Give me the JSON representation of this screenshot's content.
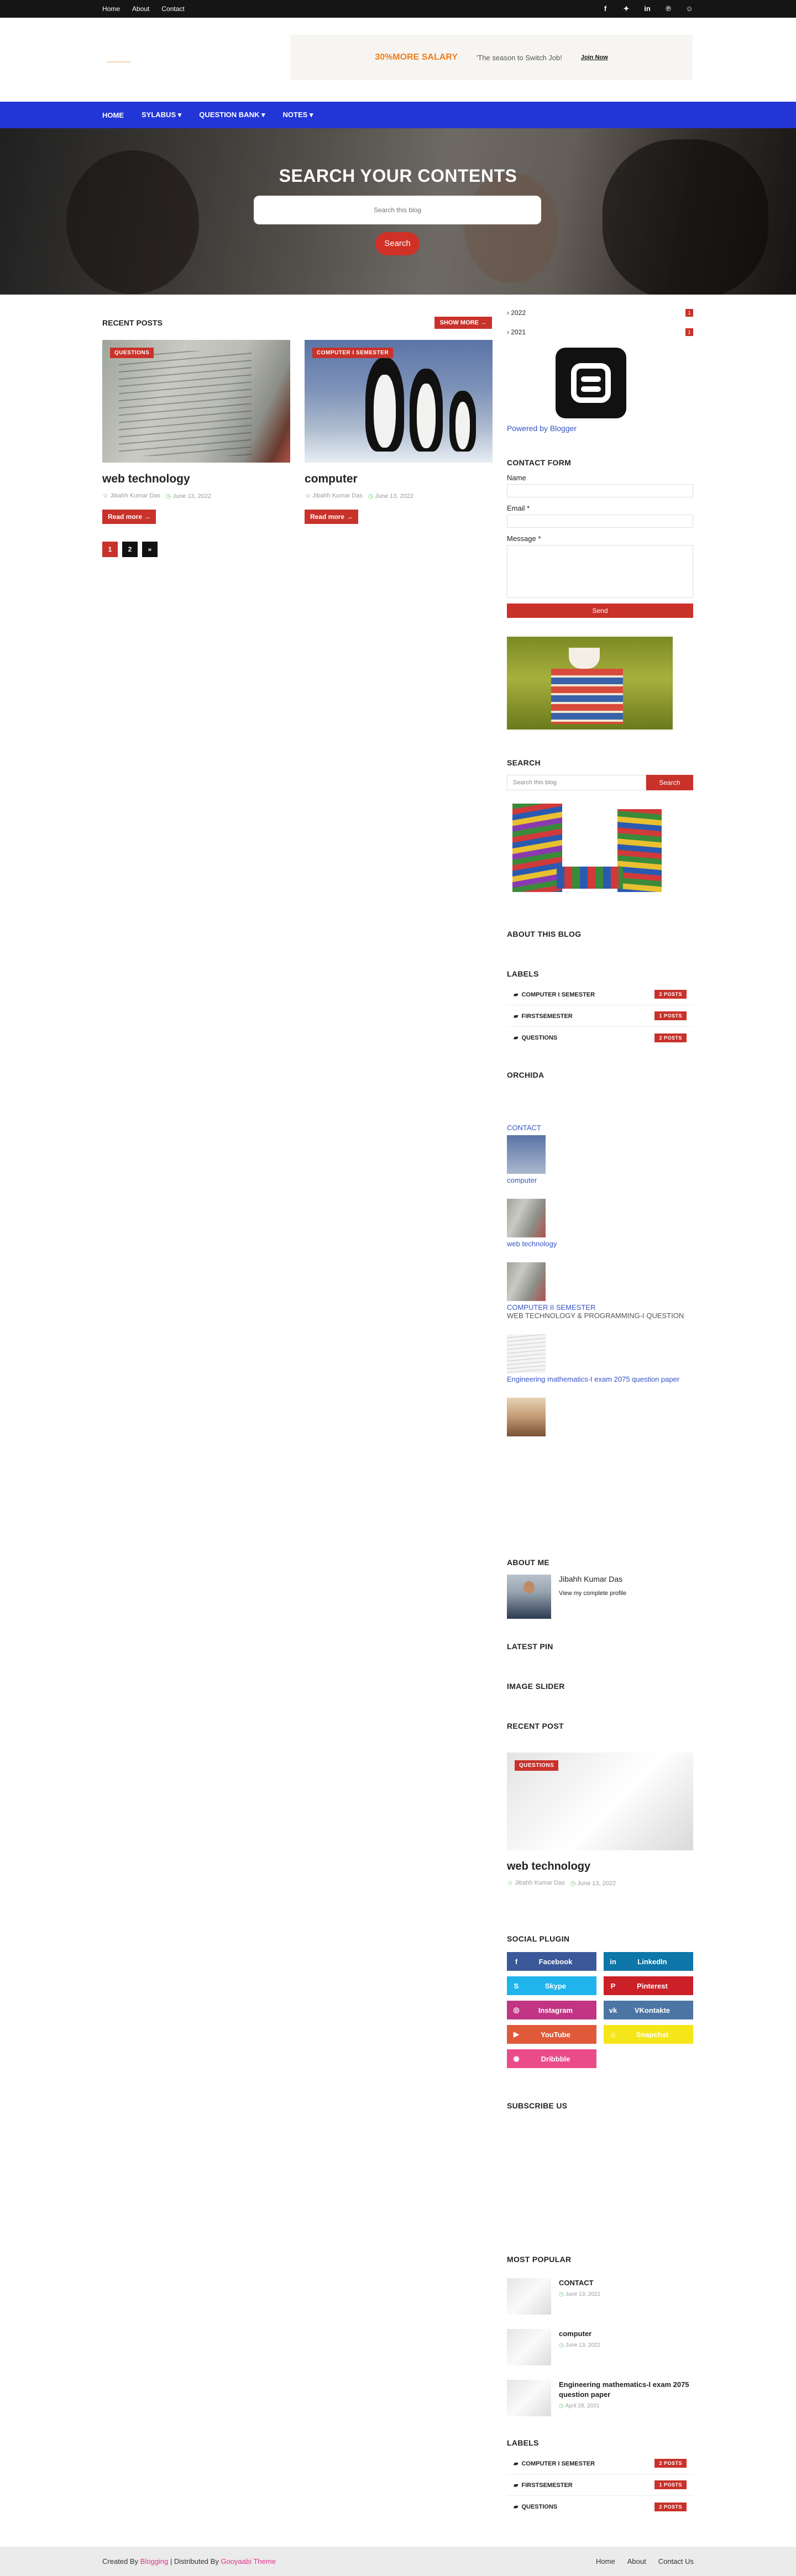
{
  "topbar": {
    "links": [
      "Home",
      "About",
      "Contact"
    ],
    "social_icons": [
      "facebook-icon",
      "twitter-icon",
      "linkedin-icon",
      "pinterest-icon",
      "snapchat-icon"
    ]
  },
  "header": {
    "logo_alt": "LOGO",
    "ad": {
      "headline": "30%MORE SALARY",
      "tagline": "'The season to Switch Job!",
      "cta": "Join Now"
    }
  },
  "nav": {
    "items": [
      "HOME",
      "SYLABUS",
      "QUESTION BANK",
      "NOTES"
    ]
  },
  "hero": {
    "title": "SEARCH YOUR CONTENTS",
    "placeholder": "Search this blog",
    "button": "Search"
  },
  "main": {
    "recent_title": "RECENT POSTS",
    "show_more": "SHOW MORE",
    "posts": [
      {
        "badge": "QUESTIONS",
        "title": "web technology",
        "author": "Jibahh Kumar Das",
        "date": "June 13, 2022",
        "read_more": "Read more"
      },
      {
        "badge": "COMPUTER I SEMESTER",
        "title": "computer",
        "author": "Jibahh Kumar Das",
        "date": "June 13, 2022",
        "read_more": "Read more"
      }
    ],
    "pager": [
      "1",
      "2",
      "»"
    ]
  },
  "sidebar": {
    "archive": [
      {
        "label": "2022",
        "count": "1"
      },
      {
        "label": "2021",
        "count": "1"
      }
    ],
    "powered_by": "Powered by Blogger",
    "contact": {
      "title": "CONTACT FORM",
      "name_label": "Name",
      "email_label": "Email *",
      "message_label": "Message *",
      "send": "Send"
    },
    "search": {
      "title": "SEARCH",
      "placeholder": "Search this blog",
      "button": "Search"
    },
    "about_blog_title": "ABOUT THIS BLOG",
    "labels_title": "LABELS",
    "labels": [
      {
        "name": "COMPUTER I SEMESTER",
        "count": "2 POSTS"
      },
      {
        "name": "FIRSTSEMESTER",
        "count": "1 POSTS"
      },
      {
        "name": "QUESTIONS",
        "count": "2 POSTS"
      }
    ],
    "orchida_title": "ORCHIDA",
    "orchida_links": {
      "contact": "CONTACT",
      "computer": "computer",
      "web_technology": "web technology",
      "computer_ii": "COMPUTER II SEMESTER",
      "wtp_question": "WEB TECHNOLOGY & PROGRAMMING-I QUESTION",
      "engineering": "Engineering mathematics-I exam 2075 question paper"
    },
    "about_me": {
      "title": "ABOUT ME",
      "name": "Jibahh Kumar Das",
      "profile_link": "View my complete profile"
    },
    "latest_pin_title": "LATEST PIN",
    "image_slider_title": "IMAGE SLIDER",
    "recent_post": {
      "title": "RECENT POST",
      "badge": "QUESTIONS",
      "post_title": "web technology",
      "author": "Jibahh Kumar Das",
      "date": "June 13, 2022"
    },
    "social_plugin": {
      "title": "SOCIAL PLUGIN",
      "items": [
        {
          "label": "Facebook",
          "icon": "f",
          "color": "#3b5998"
        },
        {
          "label": "LinkedIn",
          "icon": "in",
          "color": "#0e76a8"
        },
        {
          "label": "Skype",
          "icon": "S",
          "color": "#1fb4ec"
        },
        {
          "label": "Pinterest",
          "icon": "P",
          "color": "#cb2027"
        },
        {
          "label": "Instagram",
          "icon": "◎",
          "color": "#c13584"
        },
        {
          "label": "VKontakte",
          "icon": "vk",
          "color": "#4c75a3"
        },
        {
          "label": "YouTube",
          "icon": "▶",
          "color": "#e05a3a"
        },
        {
          "label": "Snapchat",
          "icon": "☺",
          "color": "#f5e61a"
        },
        {
          "label": "Dribbble",
          "icon": "◉",
          "color": "#ea4c89"
        }
      ]
    },
    "subscribe_title": "SUBSCRIBE US",
    "most_popular": {
      "title": "MOST POPULAR",
      "items": [
        {
          "title": "CONTACT",
          "date": "June 13, 2022"
        },
        {
          "title": "computer",
          "date": "June 13, 2022"
        },
        {
          "title": "Engineering mathematics-I exam 2075 question paper",
          "date": "April 28, 2021"
        }
      ]
    },
    "labels2_title": "LABELS"
  },
  "footer": {
    "created_by_prefix": "Created By",
    "created_by": "Blogging",
    "distributed_prefix": "| Distributed By",
    "distributed_by": "Gooyaabi Theme",
    "links": [
      "Home",
      "About",
      "Contact Us"
    ]
  }
}
